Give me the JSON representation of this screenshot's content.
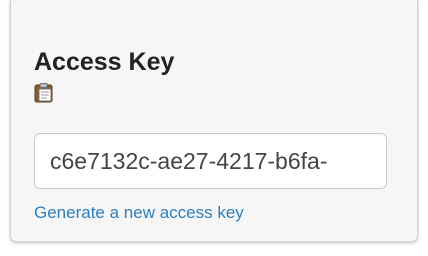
{
  "access_key": {
    "heading": "Access Key",
    "copy_icon": "clipboard-copy-icon",
    "value": "c6e7132c-ae27-4217-b6fa-",
    "generate_link_label": "Generate a new access key"
  },
  "colors": {
    "panel_background": "#f6f6f6",
    "link": "#2a7fc1",
    "heading_text": "#222222"
  }
}
